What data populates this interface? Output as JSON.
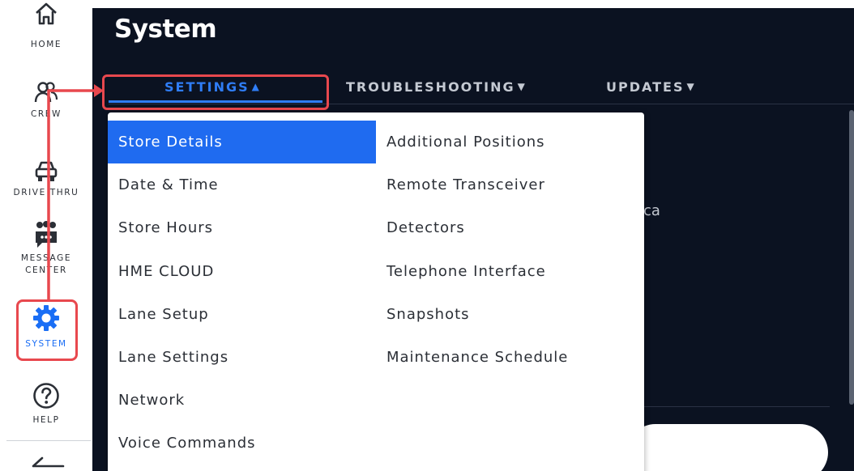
{
  "sidebar": {
    "items": [
      {
        "label": "HOME",
        "icon": "home-icon"
      },
      {
        "label": "CREW",
        "icon": "crew-icon"
      },
      {
        "label": "DRIVE THRU",
        "icon": "car-icon"
      },
      {
        "label": "MESSAGE CENTER",
        "icon": "message-center-icon"
      },
      {
        "label": "SYSTEM",
        "icon": "gear-icon",
        "active": true
      },
      {
        "label": "HELP",
        "icon": "help-icon"
      }
    ]
  },
  "header": {
    "title": "System"
  },
  "tabs": [
    {
      "label": "SETTINGS",
      "state": "expanded",
      "chevron": "chevron-up-icon"
    },
    {
      "label": "TROUBLESHOOTING",
      "state": "collapsed",
      "chevron": "chevron-down-icon"
    },
    {
      "label": "UPDATES",
      "state": "collapsed",
      "chevron": "chevron-down-icon"
    }
  ],
  "dropdown": {
    "left_column": [
      "Store Details",
      "Date & Time",
      "Store Hours",
      "HME CLOUD",
      "Lane Setup",
      "Lane Settings",
      "Network",
      "Voice Commands"
    ],
    "right_column": [
      "Additional Positions",
      "Remote Transceiver",
      "Detectors",
      "Telephone Interface",
      "Snapshots",
      "Maintenance Schedule"
    ],
    "selected": "Store Details"
  },
  "background": {
    "partial_text": "ca"
  },
  "colors": {
    "accent": "#1f6bf0",
    "header_bg": "#0b1221",
    "annotation": "#e8484e"
  }
}
